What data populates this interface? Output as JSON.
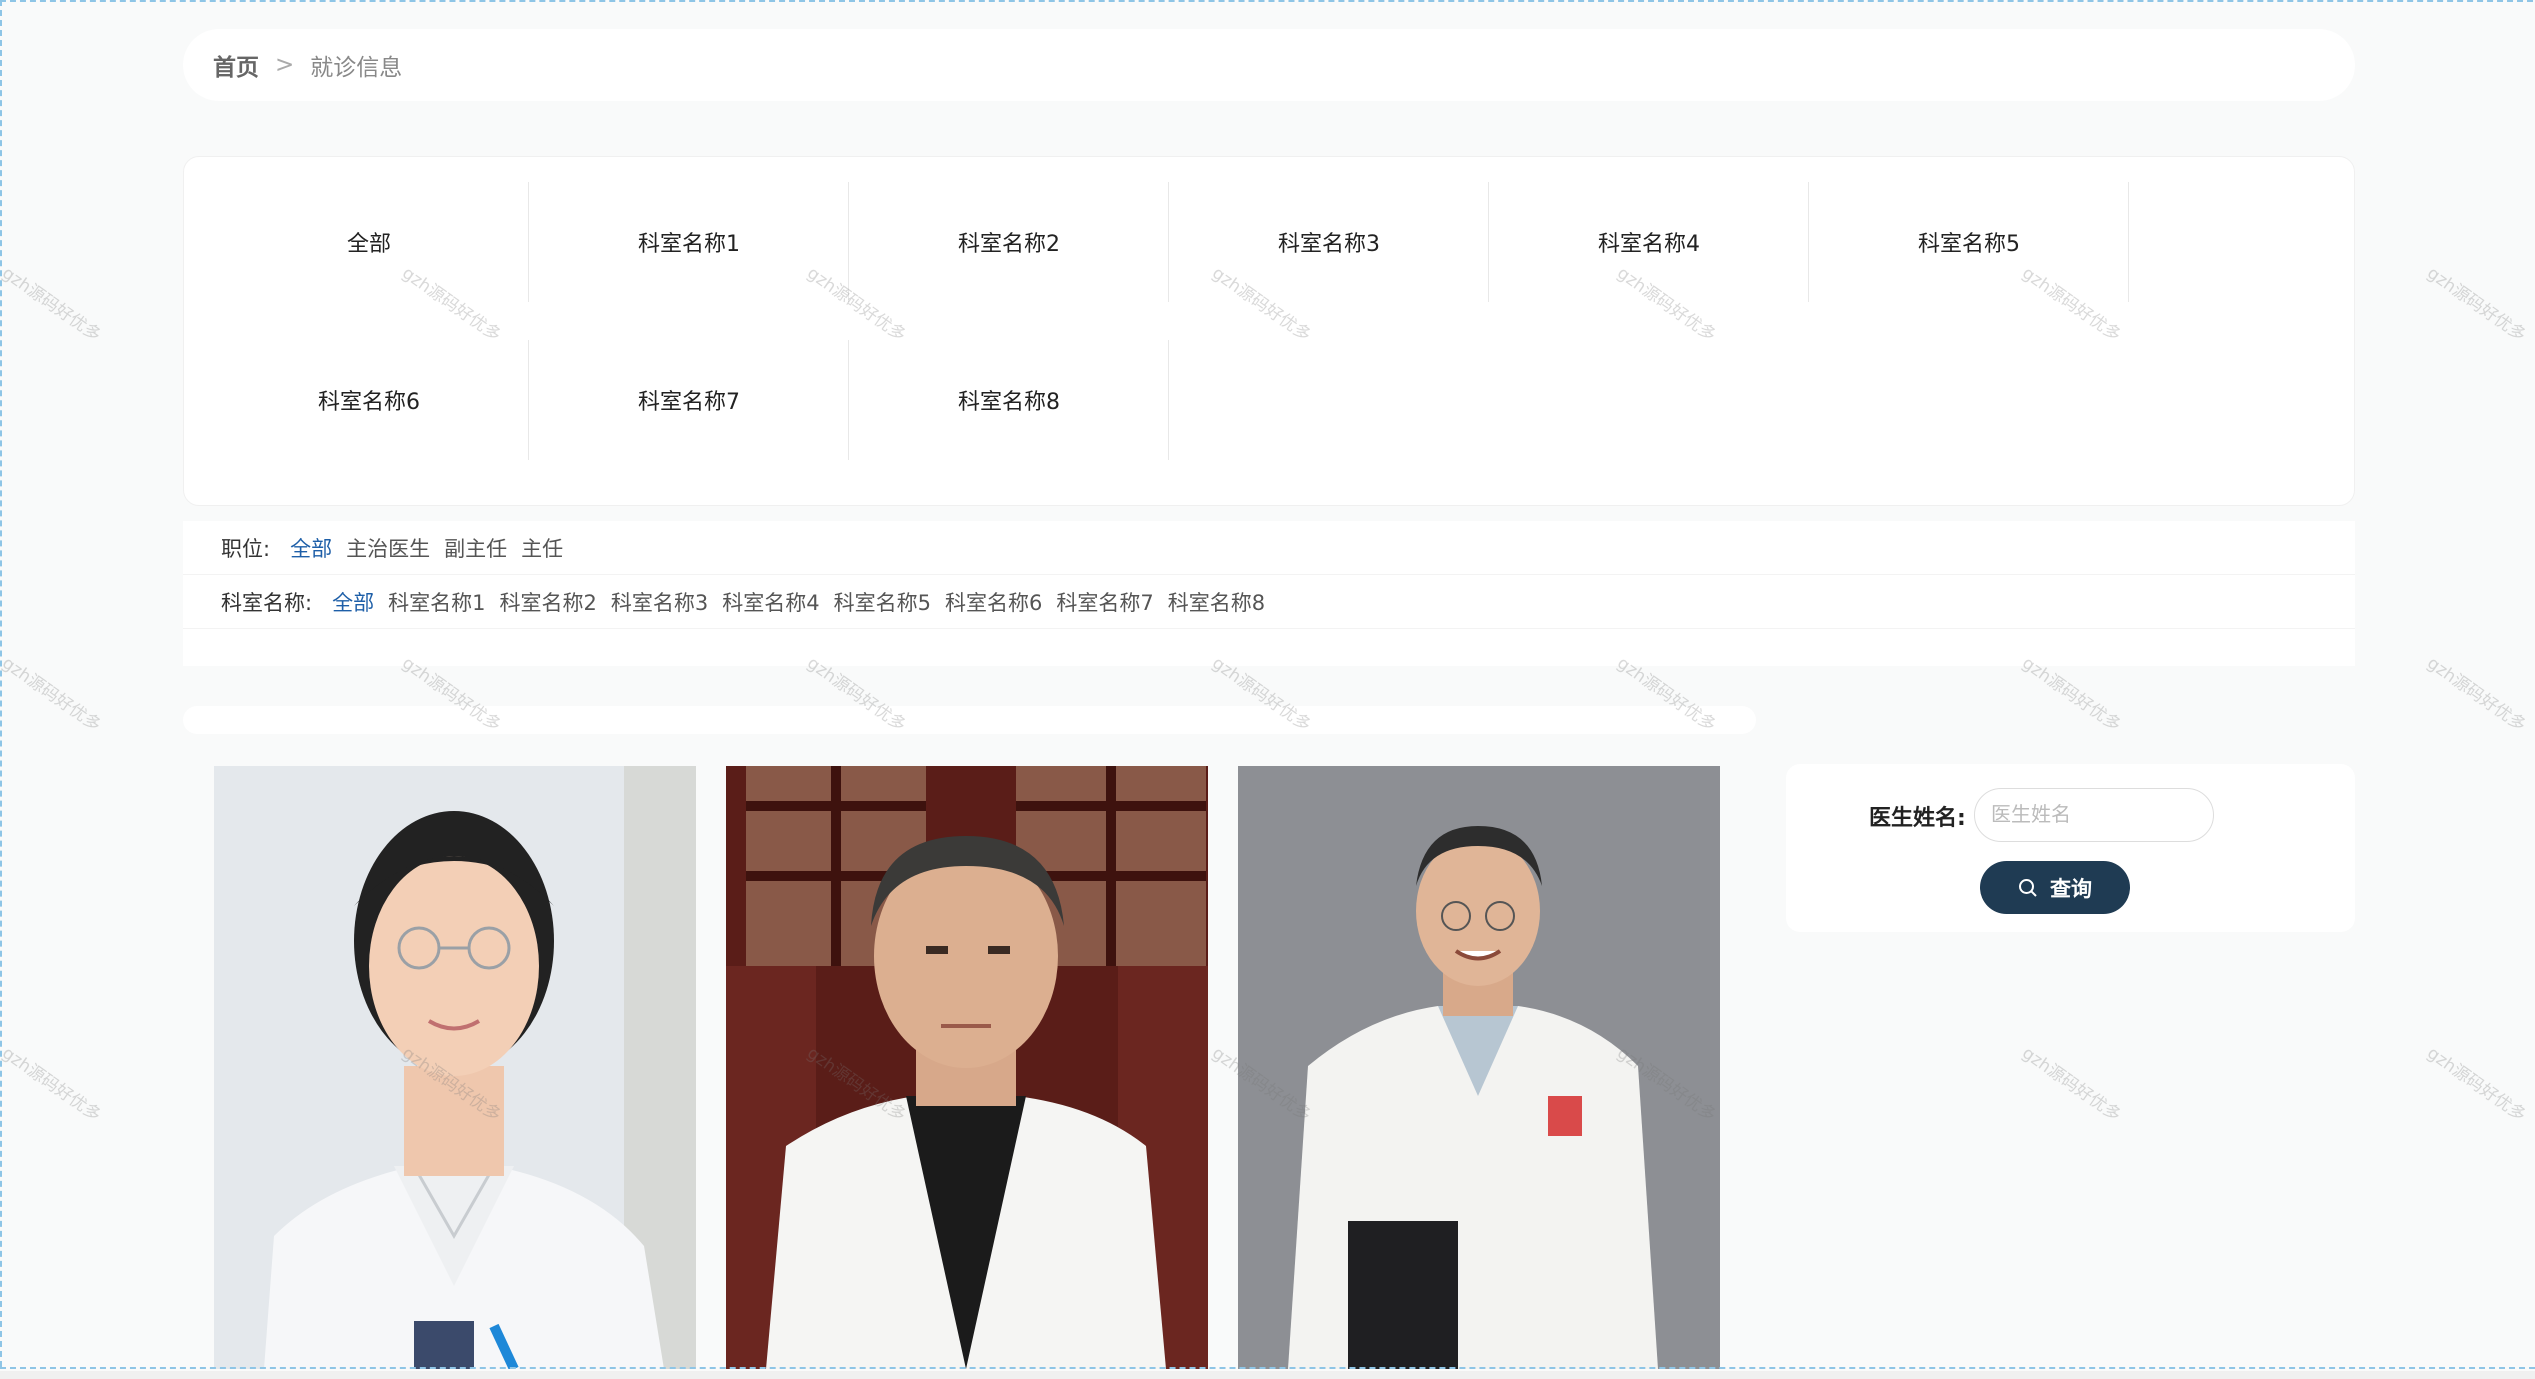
{
  "breadcrumb": {
    "home": "首页",
    "separator": ">",
    "current": "就诊信息"
  },
  "departments": [
    "全部",
    "科室名称1",
    "科室名称2",
    "科室名称3",
    "科室名称4",
    "科室名称5",
    "科室名称6",
    "科室名称7",
    "科室名称8"
  ],
  "filters": {
    "position": {
      "label": "职位:",
      "options": [
        "全部",
        "主治医生",
        "副主任",
        "主任"
      ],
      "active": "全部"
    },
    "department": {
      "label": "科室名称:",
      "options": [
        "全部",
        "科室名称1",
        "科室名称2",
        "科室名称3",
        "科室名称4",
        "科室名称5",
        "科室名称6",
        "科室名称7",
        "科室名称8"
      ],
      "active": "全部"
    }
  },
  "search": {
    "label": "医生姓名:",
    "placeholder": "医生姓名",
    "value": "",
    "button": "查询"
  },
  "doctors": [
    {
      "photo": "doctor-photo-female"
    },
    {
      "photo": "doctor-photo-male"
    },
    {
      "photo": "doctor-photo-senior"
    }
  ],
  "watermark": "gzh源码好优多",
  "colors": {
    "accent": "#1e5fa8",
    "button": "#1f3b53",
    "background": "#f9fafa"
  }
}
